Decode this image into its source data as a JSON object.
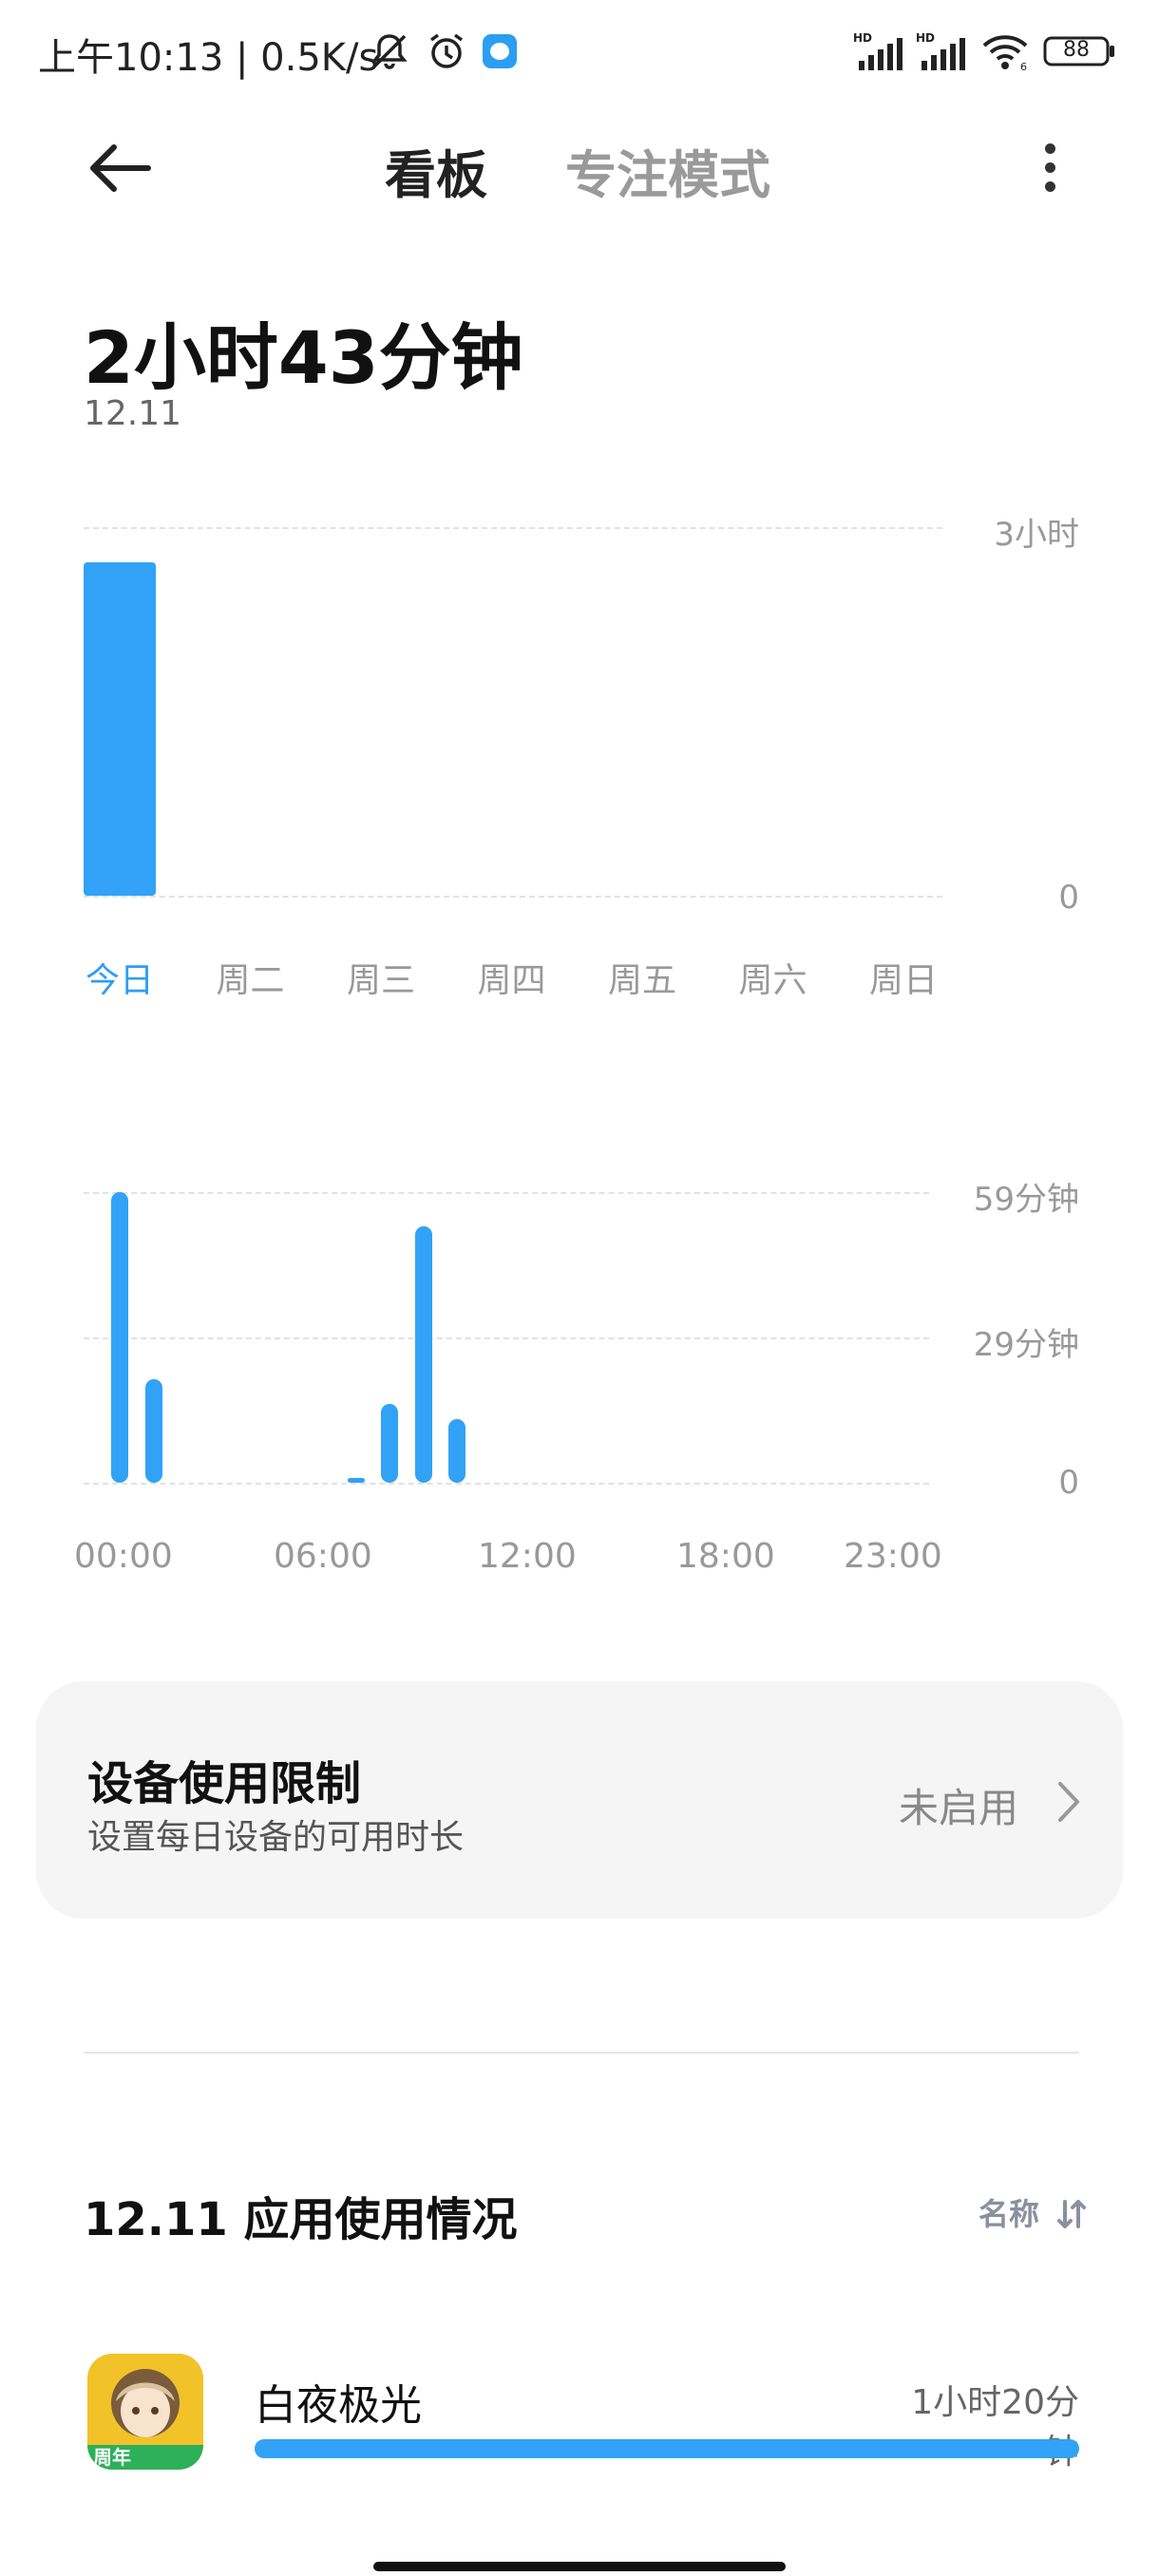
{
  "status_bar": {
    "time_speed": "上午10:13 | 0.5K/s",
    "icons": [
      "mute-icon",
      "alarm-icon",
      "app-notification-icon",
      "signal-hd-icon",
      "signal-hd-icon",
      "wifi-icon",
      "battery-icon"
    ],
    "battery": "88"
  },
  "header": {
    "back_icon": "back-arrow-icon",
    "tabs": [
      {
        "label": "看板"
      },
      {
        "label": "专注模式"
      }
    ],
    "menu_icon": "more-vert-icon"
  },
  "summary": {
    "total": "2小时43分钟",
    "date": "12.11"
  },
  "weekly_chart": {
    "type": "bar",
    "categories": [
      "今日",
      "周二",
      "周三",
      "周四",
      "周五",
      "周六",
      "周日"
    ],
    "values_minutes": [
      163,
      0,
      0,
      0,
      0,
      0,
      0
    ],
    "ylim_minutes": [
      0,
      180
    ],
    "y_tick_labels": [
      "3小时",
      "0"
    ],
    "active_index": 0,
    "accent": "#31a2f5"
  },
  "hourly_chart": {
    "type": "bar",
    "x_tick_labels": [
      "00:00",
      "06:00",
      "12:00",
      "18:00",
      "23:00"
    ],
    "y_tick_labels": [
      "59分钟",
      "29分钟",
      "0"
    ],
    "ylim_minutes": [
      0,
      59
    ],
    "bars": [
      {
        "hour": 0,
        "minutes": 59
      },
      {
        "hour": 1,
        "minutes": 21
      },
      {
        "hour": 7,
        "minutes": 1
      },
      {
        "hour": 8,
        "minutes": 16
      },
      {
        "hour": 9,
        "minutes": 52
      },
      {
        "hour": 10,
        "minutes": 13
      }
    ]
  },
  "limit_card": {
    "title": "设备使用限制",
    "subtitle": "设置每日设备的可用时长",
    "status": "未启用",
    "chevron_icon": "chevron-right-icon"
  },
  "usage": {
    "title": "12.11 应用使用情况",
    "sort_label": "名称",
    "sort_icon": "sort-icon",
    "apps": [
      {
        "name": "白夜极光",
        "time": "1小时20分钟",
        "fraction": 1.0,
        "icon": "app-game-icon"
      }
    ]
  }
}
